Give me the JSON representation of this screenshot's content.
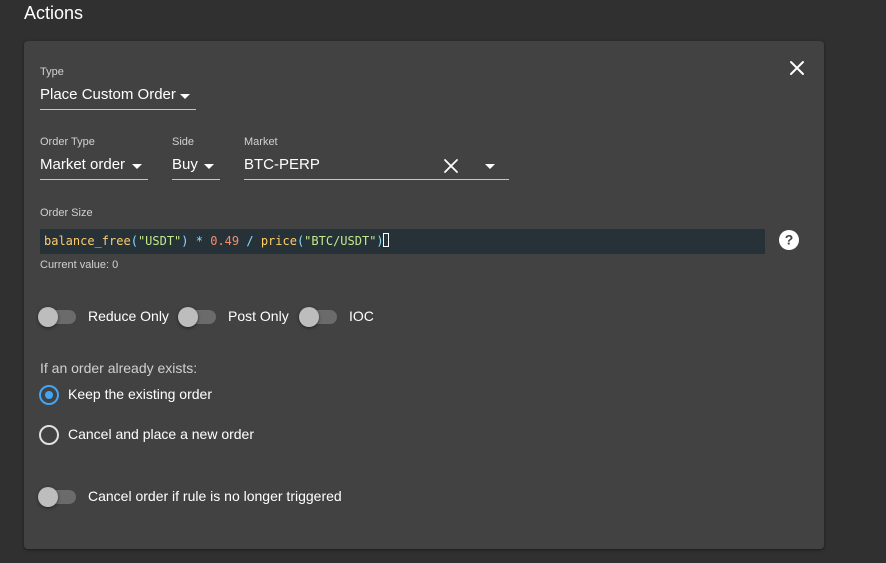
{
  "section": {
    "title": "Actions"
  },
  "card": {
    "close_icon": "close-icon",
    "type_field": {
      "label": "Type",
      "value": "Place Custom Order"
    },
    "order_type_field": {
      "label": "Order Type",
      "value": "Market order"
    },
    "side_field": {
      "label": "Side",
      "value": "Buy"
    },
    "market_field": {
      "label": "Market",
      "value": "BTC-PERP"
    },
    "order_size": {
      "label": "Order Size",
      "expression": "balance_free(\"USDT\") * 0.49 / price(\"BTC/USDT\")",
      "tokens": {
        "fn1": "balance_free",
        "open1": "(",
        "str1": "\"USDT\"",
        "close1": ")",
        "op1": " * ",
        "num": "0.49",
        "op2": " / ",
        "fn2": "price",
        "open2": "(",
        "str2": "\"BTC/USDT\"",
        "close2": ")"
      },
      "current_value": "Current value: 0",
      "help_icon": "help-icon"
    },
    "switches": [
      {
        "label": "Reduce Only",
        "checked": false
      },
      {
        "label": "Post Only",
        "checked": false
      },
      {
        "label": "IOC",
        "checked": false
      }
    ],
    "existing_order": {
      "label": "If an order already exists:",
      "options": [
        {
          "label": "Keep the existing order",
          "checked": true
        },
        {
          "label": "Cancel and place a new order",
          "checked": false
        }
      ]
    },
    "cancel_switch": {
      "label": "Cancel order if rule is no longer triggered",
      "checked": false
    }
  },
  "colors": {
    "background": "#303030",
    "card": "#424242",
    "accent": "#42a5f5",
    "code_background": "#263238"
  }
}
